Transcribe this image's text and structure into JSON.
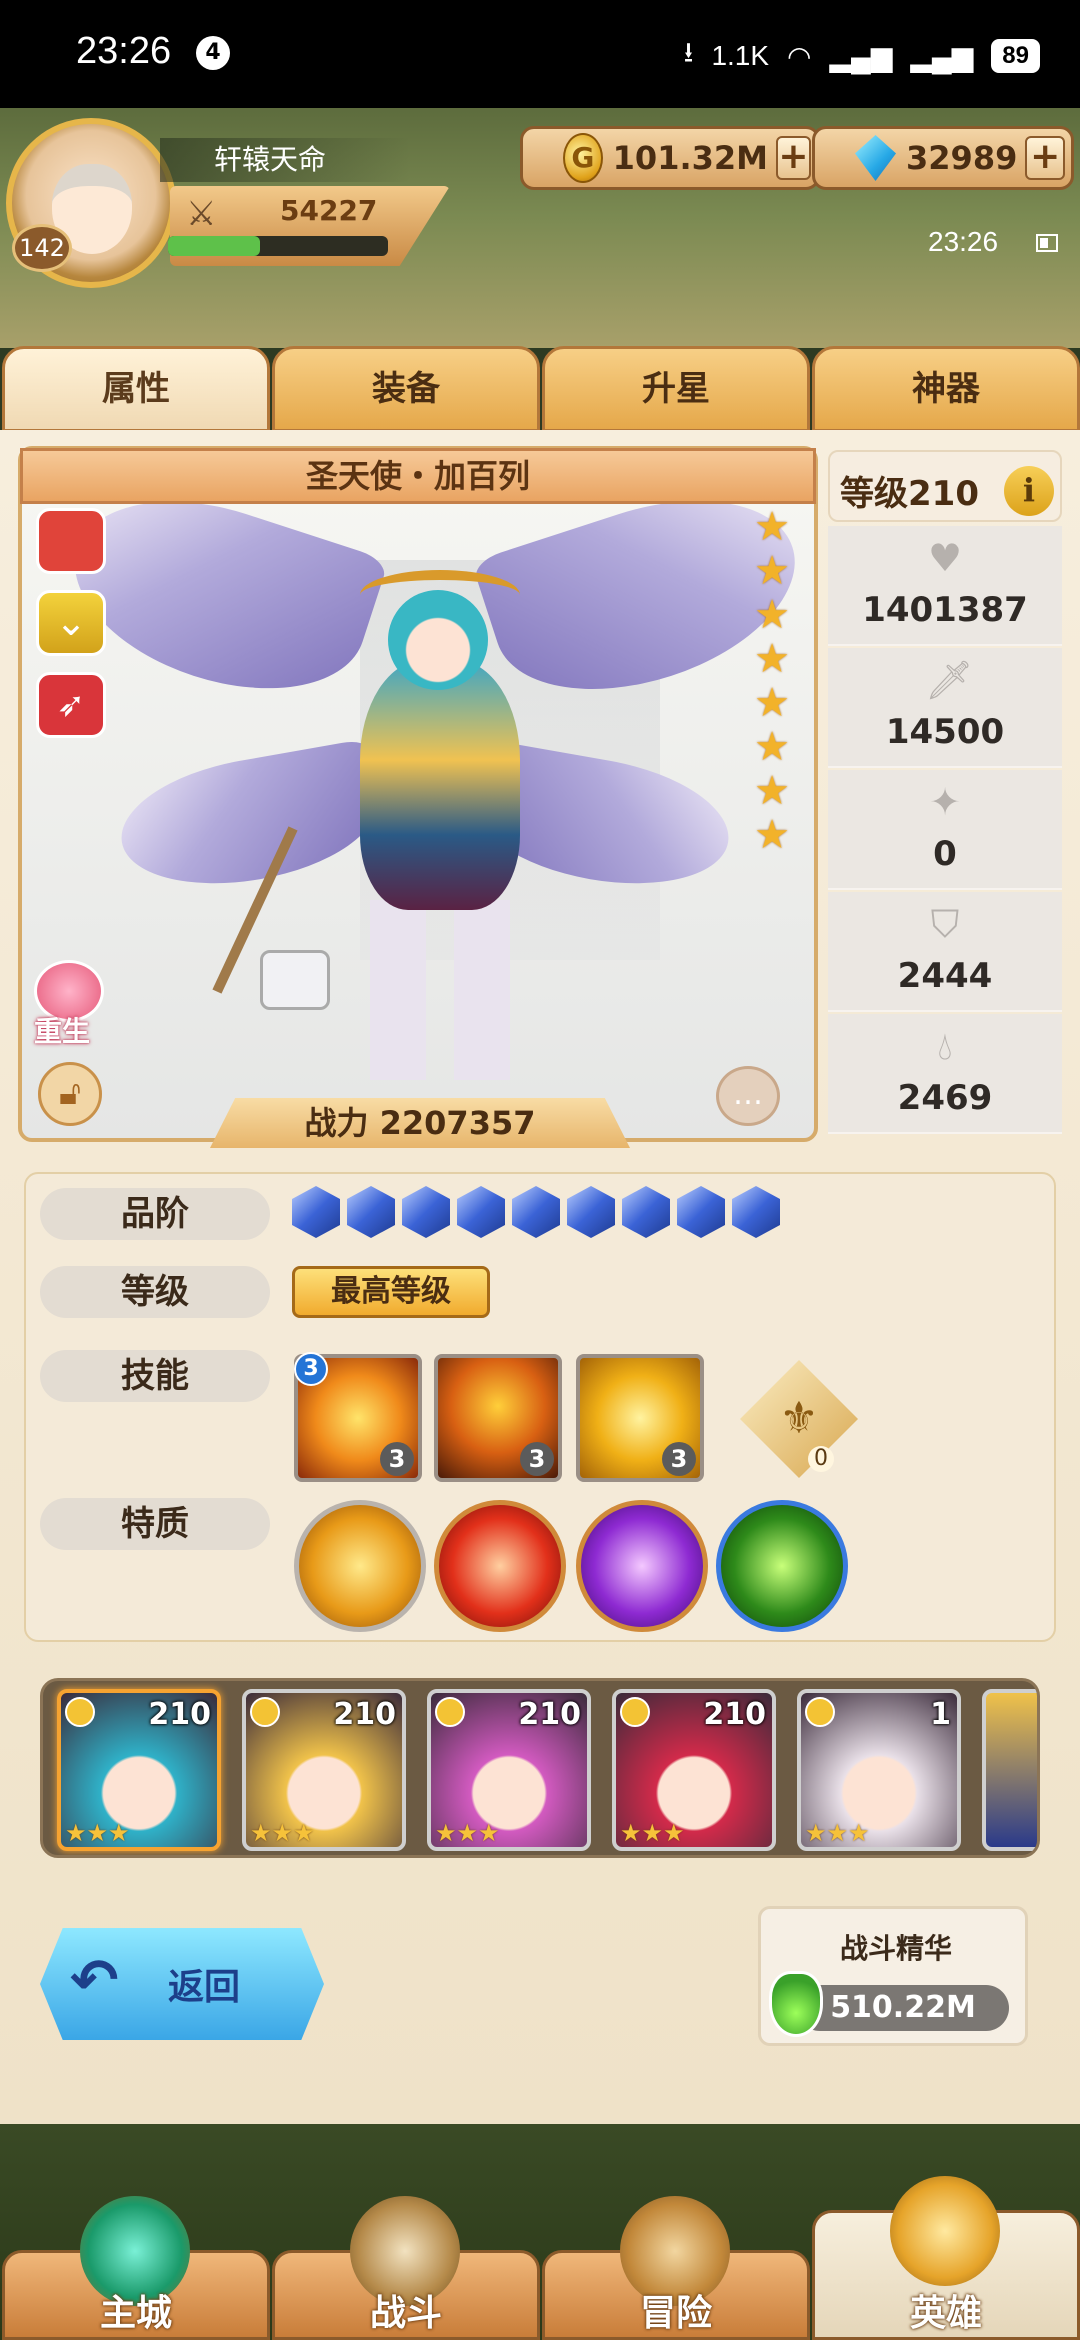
{
  "status_bar": {
    "time": "23:26",
    "notification_count": "4",
    "net_speed": "1.1K",
    "battery": "89"
  },
  "player": {
    "name": "轩辕天命",
    "level": "142",
    "power": "54227",
    "exp_fraction": 0.42
  },
  "currency": {
    "gold": "101.32M",
    "gems": "32989",
    "plus": "+"
  },
  "game_clock": "23:26",
  "tabs": [
    {
      "label": "属性",
      "active": true
    },
    {
      "label": "装备",
      "active": false
    },
    {
      "label": "升星",
      "active": false
    },
    {
      "label": "神器",
      "active": false
    }
  ],
  "hero": {
    "name": "圣天使・加百列",
    "combat_power": "战力 2207357",
    "star_count": 8,
    "rebirth_label": "重生"
  },
  "stats": {
    "level_label": "等级210",
    "info_label": "i",
    "values": [
      {
        "icon": "heart-icon",
        "value": "1401387"
      },
      {
        "icon": "sword-icon",
        "value": "14500"
      },
      {
        "icon": "pin-icon",
        "value": "0"
      },
      {
        "icon": "shield-icon",
        "value": "2444"
      },
      {
        "icon": "drop-icon",
        "value": "2469"
      }
    ]
  },
  "attributes": {
    "rank_label": "品阶",
    "rank_gems": 9,
    "level_label": "等级",
    "max_level": "最高等级",
    "skills_label": "技能",
    "skill_badge": "3",
    "skills": [
      {
        "level": "3"
      },
      {
        "level": "3"
      },
      {
        "level": "3"
      }
    ],
    "artifact_level": "0",
    "traits_label": "特质"
  },
  "roster": [
    {
      "level": "210",
      "stars": "★★★",
      "color": "#2fb1c8",
      "selected": true
    },
    {
      "level": "210",
      "stars": "★★★",
      "color": "#f0c24a",
      "selected": false
    },
    {
      "level": "210",
      "stars": "★★★",
      "color": "#d25ac0",
      "selected": false
    },
    {
      "level": "210",
      "stars": "★★★",
      "color": "#d22a4a",
      "selected": false
    },
    {
      "level": "1",
      "stars": "★★★",
      "color": "#e9e0e8",
      "selected": false
    }
  ],
  "actions": {
    "back_label": "返回",
    "essence_title": "战斗精华",
    "essence_value": "510.22M"
  },
  "nav": [
    {
      "label": "主城",
      "active": false
    },
    {
      "label": "战斗",
      "active": false
    },
    {
      "label": "冒险",
      "active": false
    },
    {
      "label": "英雄",
      "active": true
    }
  ],
  "colors": {
    "accent": "#f6a331",
    "panel": "#f4ead8",
    "tab_active": "#fff2d8"
  }
}
